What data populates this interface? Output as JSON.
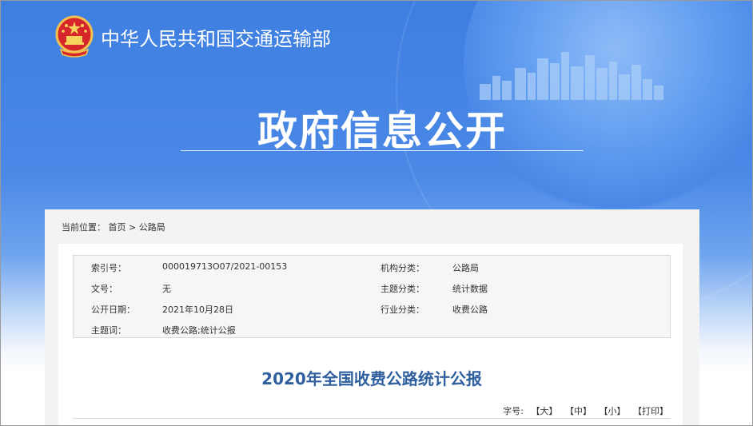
{
  "header": {
    "ministry_name": "中华人民共和国交通运输部",
    "section_title": "政府信息公开"
  },
  "breadcrumb": {
    "prefix": "当前位置：",
    "items": [
      "首页",
      "公路局"
    ],
    "separator": " > "
  },
  "meta": {
    "rows": [
      {
        "k1": "索引号：",
        "v1": "000019713O07/2021-00153",
        "k2": "机构分类：",
        "v2": "公路局"
      },
      {
        "k1": "文号：",
        "v1": "无",
        "k2": "主题分类：",
        "v2": "统计数据"
      },
      {
        "k1": "公开日期：",
        "v1": "2021年10月28日",
        "k2": "行业分类：",
        "v2": "收费公路"
      },
      {
        "k1": "主题词：",
        "v1": "收费公路;统计公报",
        "k2": "",
        "v2": ""
      }
    ]
  },
  "article": {
    "title": "2020年全国收费公路统计公报"
  },
  "font_size": {
    "label": "字号:",
    "large": "【大】",
    "medium": "【中】",
    "small": "【小】",
    "print": "【打印】"
  },
  "colors": {
    "banner_blue": "#3d7fe0",
    "title_blue": "#2f5f9e"
  }
}
